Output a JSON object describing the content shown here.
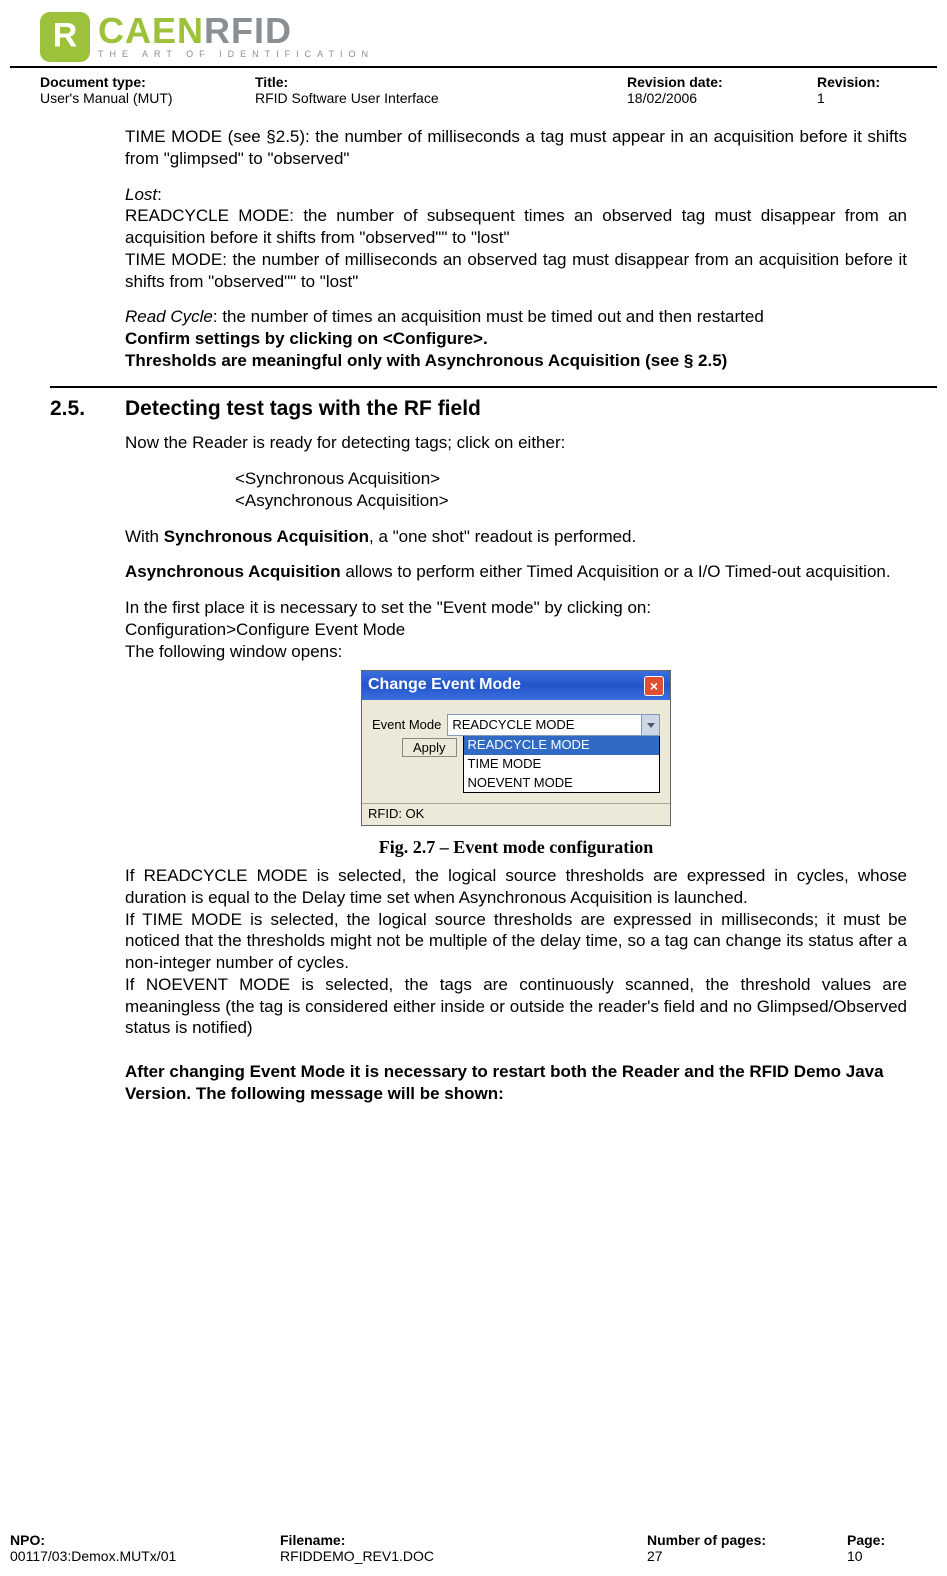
{
  "logo": {
    "main": "CAEN",
    "sub": "RFID",
    "tagline": "THE ART OF IDENTIFICATION"
  },
  "meta_top": {
    "doc_type_label": "Document type:",
    "doc_type_value": "User's Manual (MUT)",
    "title_label": "Title:",
    "title_value": "RFID Software User Interface",
    "rev_date_label": "Revision date:",
    "rev_date_value": "18/02/2006",
    "rev_label": "Revision:",
    "rev_value": "1"
  },
  "body": {
    "p1": "TIME MODE (see §2.5): the number of milliseconds a tag must appear in an acquisition before it shifts from \"glimpsed\" to \"observed\"",
    "lost_label": "Lost",
    "lost_colon": ":",
    "p2": "READCYCLE MODE: the number of subsequent times an observed tag must disappear from an acquisition before it shifts from \"observed\"\" to \"lost\"",
    "p3": "TIME MODE: the number of milliseconds an observed tag must disappear from an acquisition before it shifts from \"observed\"\" to \"lost\"",
    "readcycle_label": "Read Cycle",
    "readcycle_text": ": the number of times an acquisition must be timed out and then restarted",
    "confirm": "Confirm settings by clicking on <Configure>.",
    "thresholds": "Thresholds are meaningful only with Asynchronous Acquisition (see § 2.5)",
    "sec_num": "2.5.",
    "sec_title": "Detecting test tags with the RF field",
    "p4": "Now the Reader is ready for detecting tags; click on either:",
    "sync": "<Synchronous Acquisition>",
    "async": "<Asynchronous Acquisition>",
    "p5a": "With ",
    "p5b": "Synchronous Acquisition",
    "p5c": ", a \"one shot\" readout is performed.",
    "p6a": "Asynchronous Acquisition",
    "p6b": " allows to perform either Timed Acquisition or a I/O Timed-out acquisition.",
    "p7": "In the first place it is necessary to set the \"Event mode\" by clicking on:",
    "p8": "Configuration>Configure Event Mode",
    "p9": "The following window opens:",
    "fig_caption": "Fig. 2.7 – Event mode configuration",
    "p10": "If READCYCLE MODE is selected, the logical source thresholds are expressed in cycles, whose duration is equal to the Delay time set when Asynchronous Acquisition is launched.",
    "p11": "If TIME MODE is selected, the logical source thresholds are expressed in milliseconds; it must be noticed that the thresholds might not be multiple of the delay time, so a tag can change its status after a non-integer number of cycles.",
    "p12": "If NOEVENT MODE is selected, the tags are continuously scanned, the threshold values are meaningless (the tag is considered either inside or outside the reader's field and no Glimpsed/Observed status is notified)",
    "p13": "After changing Event Mode it is necessary to restart both the Reader and the RFID Demo Java Version. The following message will be shown:"
  },
  "window": {
    "title": "Change Event Mode",
    "label": "Event Mode",
    "selected": "READCYCLE MODE",
    "options": [
      "READCYCLE MODE",
      "TIME MODE",
      "NOEVENT MODE"
    ],
    "apply": "Apply",
    "status": "RFID: OK"
  },
  "footer": {
    "npo_label": "NPO:",
    "npo_value": "00117/03:Demox.MUTx/01",
    "file_label": "Filename:",
    "file_value": "RFIDDEMO_REV1.DOC",
    "pages_label": "Number of pages:",
    "pages_value": "27",
    "page_label": "Page:",
    "page_value": "10"
  }
}
